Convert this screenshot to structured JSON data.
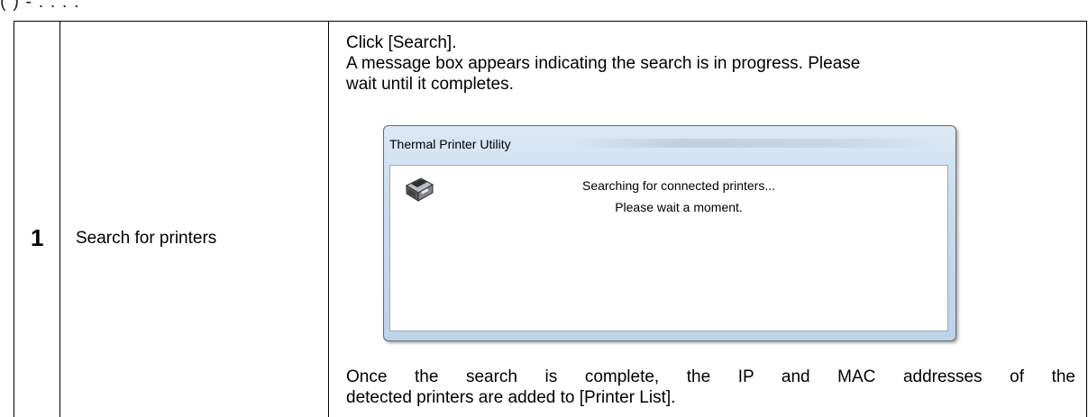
{
  "step": {
    "number": "1",
    "title": "Search for printers"
  },
  "description": {
    "line1": "Click [Search].",
    "line2": "A message box appears indicating the search is in progress. Please",
    "line3": "wait until it completes.",
    "line4": "Once the search is complete, the IP and MAC addresses of the",
    "line5": "detected printers are added to [Printer List]."
  },
  "dialog": {
    "title": "Thermal Printer Utility",
    "message1": "Searching for connected printers...",
    "message2": "Please wait a moment.",
    "icon": "printer-icon"
  }
}
